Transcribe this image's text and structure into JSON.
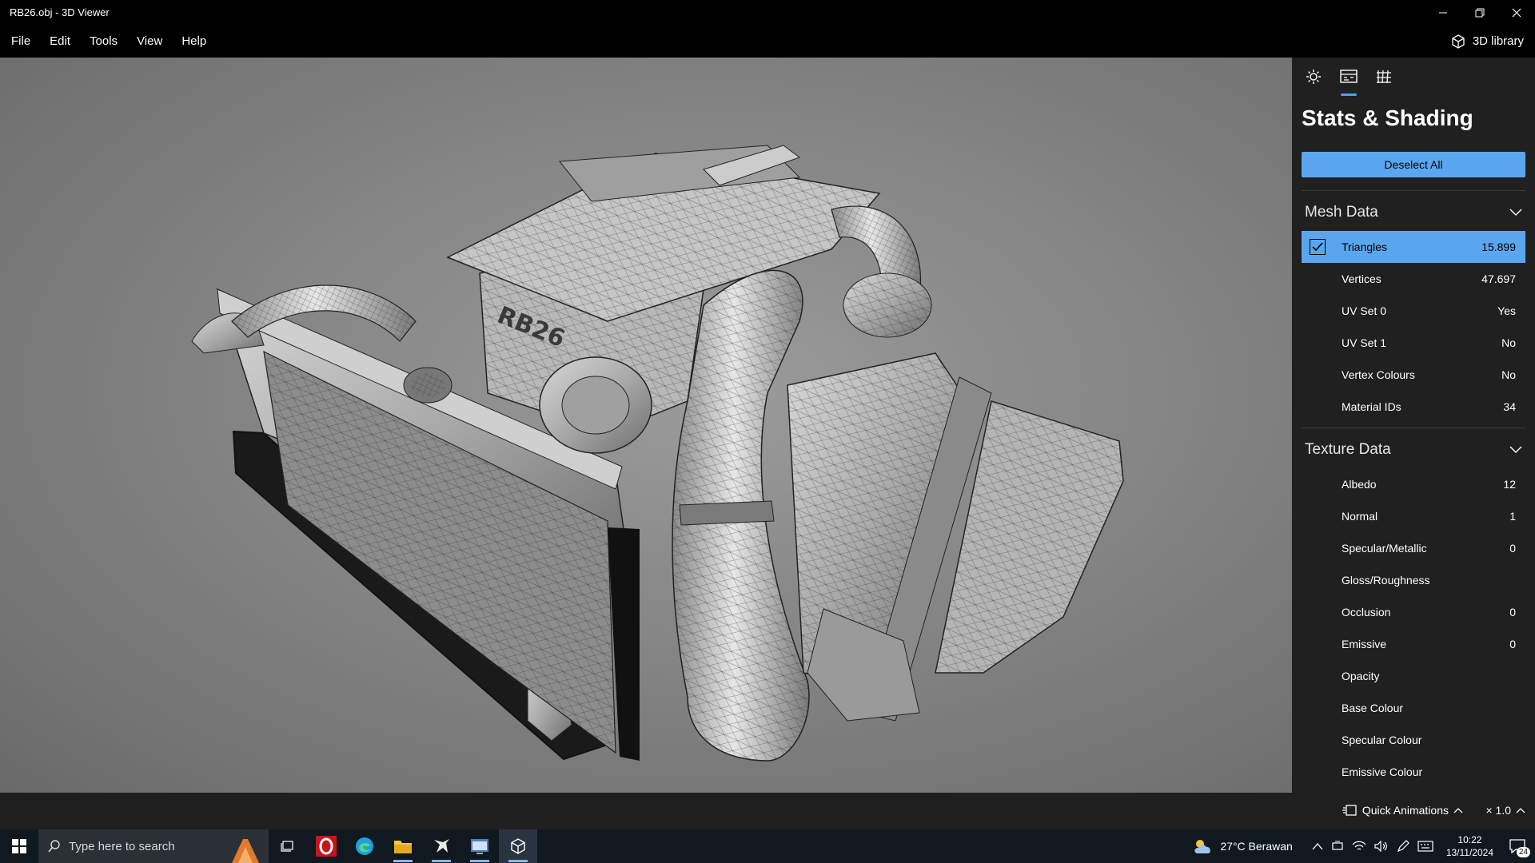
{
  "window": {
    "title": "RB26.obj - 3D Viewer"
  },
  "menu": {
    "items": [
      "File",
      "Edit",
      "Tools",
      "View",
      "Help"
    ],
    "library_label": "3D library"
  },
  "viewport": {
    "engine_text": "RB26"
  },
  "panel": {
    "tabs": [
      "lighting-icon",
      "stats-icon",
      "grid-icon"
    ],
    "title": "Stats & Shading",
    "deselect_label": "Deselect All",
    "mesh": {
      "title": "Mesh Data",
      "rows": [
        {
          "label": "Triangles",
          "value": "15.899"
        },
        {
          "label": "Vertices",
          "value": "47.697"
        },
        {
          "label": "UV Set 0",
          "value": "Yes"
        },
        {
          "label": "UV Set 1",
          "value": "No"
        },
        {
          "label": "Vertex Colours",
          "value": "No"
        },
        {
          "label": "Material IDs",
          "value": "34"
        }
      ]
    },
    "texture": {
      "title": "Texture Data",
      "rows": [
        {
          "label": "Albedo",
          "value": "12"
        },
        {
          "label": "Normal",
          "value": "1"
        },
        {
          "label": "Specular/Metallic",
          "value": "0"
        },
        {
          "label": "Gloss/Roughness",
          "value": ""
        },
        {
          "label": "Occlusion",
          "value": "0"
        },
        {
          "label": "Emissive",
          "value": "0"
        },
        {
          "label": "Opacity",
          "value": ""
        },
        {
          "label": "Base Colour",
          "value": ""
        },
        {
          "label": "Specular Colour",
          "value": ""
        },
        {
          "label": "Emissive Colour",
          "value": ""
        }
      ]
    }
  },
  "status": {
    "quick_animations": "Quick Animations",
    "zoom": "× 1.0"
  },
  "taskbar": {
    "search_placeholder": "Type here to search",
    "weather": "27°C  Berawan",
    "time": "10:22",
    "date": "13/11/2024",
    "notifications": "24"
  },
  "colors": {
    "accent": "#5aa6ee",
    "panel": "#202020",
    "titlebar": "#000000"
  }
}
